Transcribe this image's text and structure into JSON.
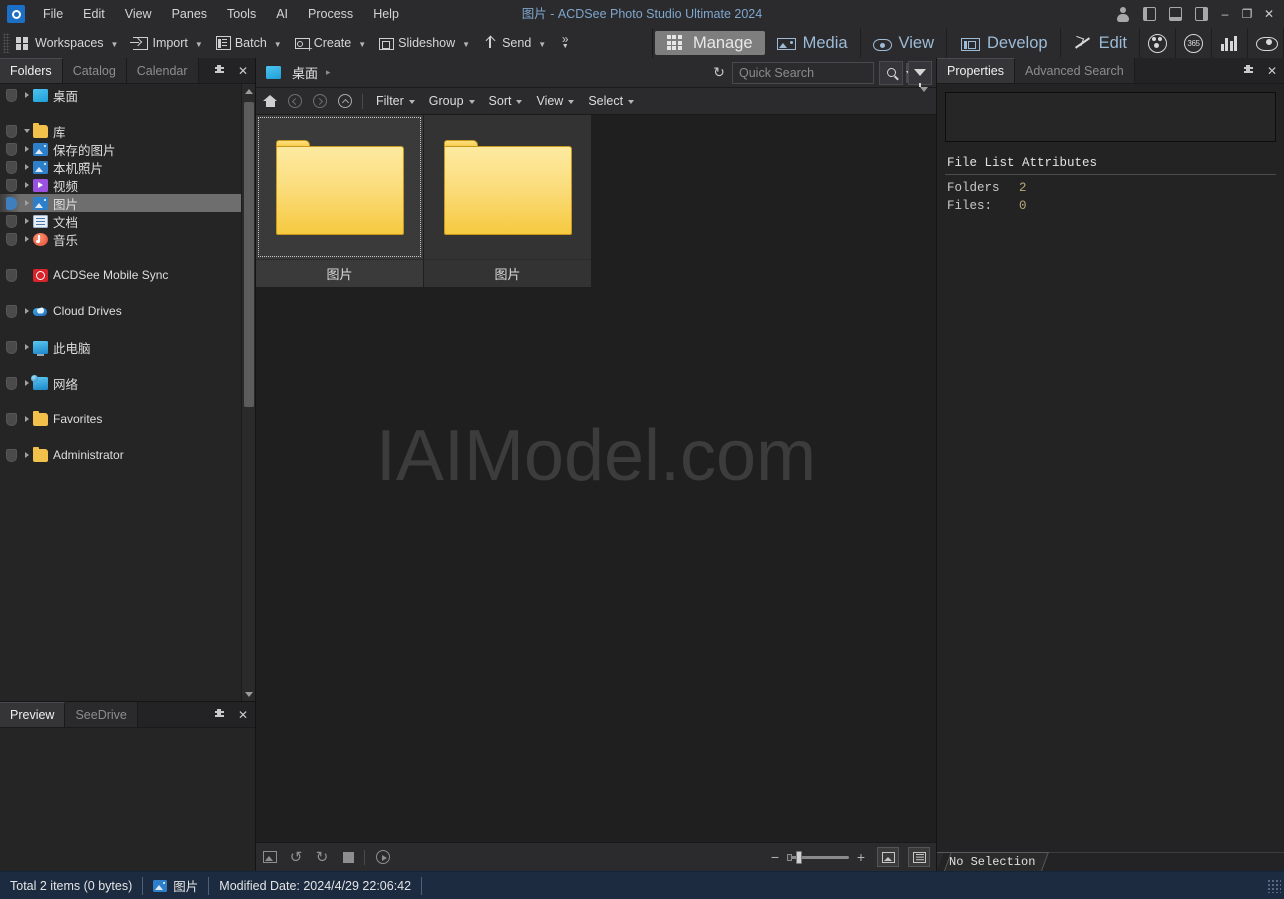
{
  "window": {
    "title": "图片 - ACDSee Photo Studio Ultimate 2024",
    "logo_icon": "acdsee-logo-icon",
    "controls": {
      "account_icon": "account-avatar-icon",
      "left_panel_icon": "left-panel-toggle-icon",
      "bottom_panel_icon": "bottom-panel-toggle-icon",
      "right_panel_icon": "right-panel-toggle-icon",
      "minimize": "–",
      "maximize": "❐",
      "close": "✕"
    }
  },
  "menubar": {
    "items": [
      {
        "label": "File"
      },
      {
        "label": "Edit"
      },
      {
        "label": "View"
      },
      {
        "label": "Panes"
      },
      {
        "label": "Tools"
      },
      {
        "label": "AI"
      },
      {
        "label": "Process"
      },
      {
        "label": "Help"
      }
    ]
  },
  "toolbar": {
    "buttons": [
      {
        "label": "Workspaces",
        "icon": "workspaces-icon",
        "has_caret": true
      },
      {
        "label": "Import",
        "icon": "import-icon",
        "has_caret": true
      },
      {
        "label": "Batch",
        "icon": "batch-icon",
        "has_caret": true
      },
      {
        "label": "Create",
        "icon": "create-icon",
        "has_caret": true
      },
      {
        "label": "Slideshow",
        "icon": "slideshow-icon",
        "has_caret": true
      },
      {
        "label": "Send",
        "icon": "send-icon",
        "has_caret": true
      }
    ],
    "overflow_label": "»"
  },
  "modebar": {
    "modes": [
      {
        "label": "Manage",
        "icon": "grid-icon",
        "active": true
      },
      {
        "label": "Media",
        "icon": "media-icon",
        "active": false
      },
      {
        "label": "View",
        "icon": "eye-icon",
        "active": false
      },
      {
        "label": "Develop",
        "icon": "develop-icon",
        "active": false
      },
      {
        "label": "Edit",
        "icon": "wand-icon",
        "active": false
      }
    ],
    "extra_buttons": [
      {
        "icon": "people-face-icon",
        "label": ""
      },
      {
        "icon": "365-icon",
        "label": "365"
      },
      {
        "icon": "bar-chart-icon",
        "label": ""
      },
      {
        "icon": "camera-eye-icon",
        "label": ""
      }
    ]
  },
  "left_panel": {
    "tabs": [
      {
        "label": "Folders",
        "active": true
      },
      {
        "label": "Catalog",
        "active": false
      },
      {
        "label": "Calendar",
        "active": false
      }
    ],
    "pin_icon": "pin-icon",
    "close_icon": "close-icon",
    "tree": [
      {
        "label": "桌面",
        "icon": "desktop-icon",
        "indent": 1,
        "expandable": true,
        "expanded": false,
        "selected": false,
        "shield": true
      },
      {
        "label": "",
        "spacer": true
      },
      {
        "label": "库",
        "icon": "folder-icon",
        "indent": 0,
        "expandable": true,
        "expanded": true,
        "selected": false,
        "shield": true
      },
      {
        "label": "保存的图片",
        "icon": "picture-icon",
        "indent": 1,
        "expandable": true,
        "expanded": false,
        "selected": false,
        "shield": true
      },
      {
        "label": "本机照片",
        "icon": "picture-icon",
        "indent": 1,
        "expandable": true,
        "expanded": false,
        "selected": false,
        "shield": true
      },
      {
        "label": "视频",
        "icon": "video-icon",
        "indent": 1,
        "expandable": true,
        "expanded": false,
        "selected": false,
        "shield": true
      },
      {
        "label": "图片",
        "icon": "picture-icon",
        "indent": 1,
        "expandable": true,
        "expanded": false,
        "selected": true,
        "shield": true
      },
      {
        "label": "文档",
        "icon": "document-icon",
        "indent": 1,
        "expandable": true,
        "expanded": false,
        "selected": false,
        "shield": true
      },
      {
        "label": "音乐",
        "icon": "music-icon",
        "indent": 1,
        "expandable": true,
        "expanded": false,
        "selected": false,
        "shield": true
      },
      {
        "label": "",
        "spacer": true
      },
      {
        "label": "ACDSee Mobile Sync",
        "icon": "acdsee-mobile-sync-icon",
        "indent": 1,
        "expandable": false,
        "expanded": false,
        "selected": false,
        "shield": true,
        "english": true
      },
      {
        "label": "",
        "spacer": true
      },
      {
        "label": "Cloud Drives",
        "icon": "cloud-icon",
        "indent": 0,
        "expandable": true,
        "expanded": false,
        "selected": false,
        "shield": true,
        "english": true
      },
      {
        "label": "",
        "spacer": true
      },
      {
        "label": "此电脑",
        "icon": "this-pc-icon",
        "indent": 0,
        "expandable": true,
        "expanded": false,
        "selected": false,
        "shield": true
      },
      {
        "label": "",
        "spacer": true
      },
      {
        "label": "网络",
        "icon": "network-icon",
        "indent": 0,
        "expandable": true,
        "expanded": false,
        "selected": false,
        "shield": true
      },
      {
        "label": "",
        "spacer": true
      },
      {
        "label": "Favorites",
        "icon": "folder-icon",
        "indent": 0,
        "expandable": true,
        "expanded": false,
        "selected": false,
        "shield": true,
        "english": true
      },
      {
        "label": "",
        "spacer": true
      },
      {
        "label": "Administrator",
        "icon": "folder-icon",
        "indent": 0,
        "expandable": true,
        "expanded": false,
        "selected": false,
        "shield": true,
        "english": true
      }
    ]
  },
  "preview_panel": {
    "tabs": [
      {
        "label": "Preview",
        "active": true
      },
      {
        "label": "SeeDrive",
        "active": false
      }
    ],
    "pin_icon": "pin-icon",
    "close_icon": "close-icon"
  },
  "center": {
    "breadcrumb": {
      "label": "桌面",
      "icon": "desktop-icon",
      "arrow": "▸"
    },
    "refresh_icon": "refresh-icon",
    "search": {
      "placeholder": "Quick Search",
      "value": ""
    },
    "search_button_icon": "search-icon",
    "filter_button_icon": "filter-funnel-icon",
    "nav_icons": [
      "home-icon",
      "back-icon",
      "forward-icon",
      "up-icon"
    ],
    "menus": [
      {
        "label": "Filter"
      },
      {
        "label": "Group"
      },
      {
        "label": "Sort"
      },
      {
        "label": "View"
      },
      {
        "label": "Select"
      }
    ],
    "thumbnails": [
      {
        "label": "图片",
        "icon": "folder-thumbnail-icon",
        "selected": true
      },
      {
        "label": "图片",
        "icon": "folder-thumbnail-icon",
        "selected": false
      }
    ],
    "watermark": "IAIModel.com",
    "bottom_icons": [
      "save-image-icon",
      "rotate-left-icon",
      "rotate-right-icon",
      "stop-icon",
      "play-icon"
    ],
    "zoom": {
      "minus": "−",
      "plus": "+"
    },
    "view_mode_icons": [
      "thumbnail-view-icon",
      "list-view-icon"
    ]
  },
  "right_panel": {
    "tabs": [
      {
        "label": "Properties",
        "active": true
      },
      {
        "label": "Advanced Search",
        "active": false
      }
    ],
    "pin_icon": "pin-icon",
    "close_icon": "close-icon",
    "section_title": "File List Attributes",
    "attributes": [
      {
        "key": "Folders",
        "value": "2"
      },
      {
        "key": "Files:",
        "value": "0"
      }
    ],
    "status_tab": "No Selection"
  },
  "statusbar": {
    "total": "Total 2 items  (0 bytes)",
    "folder_icon": "picture-folder-icon",
    "folder_name": "图片",
    "modified": "Modified Date: 2024/4/29 22:06:42"
  }
}
